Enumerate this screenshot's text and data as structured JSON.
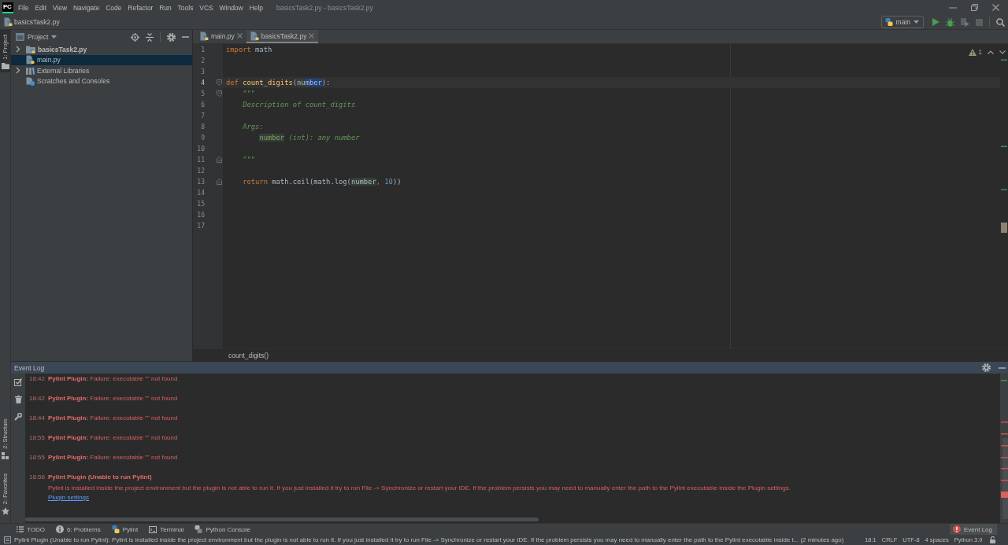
{
  "menu_bar": {
    "logo": "PC",
    "items": [
      "File",
      "Edit",
      "View",
      "Navigate",
      "Code",
      "Refactor",
      "Run",
      "Tools",
      "VCS",
      "Window",
      "Help"
    ],
    "window_title": "basicsTask2.py - basicsTask2.py"
  },
  "nav_bar": {
    "breadcrumb": "basicsTask2.py",
    "run_config": "main",
    "actions": [
      {
        "kind": "run",
        "disabled": false
      },
      {
        "kind": "debug",
        "disabled": false
      },
      {
        "kind": "coverage",
        "disabled": true
      },
      {
        "kind": "stop",
        "disabled": true
      },
      {
        "kind": "search",
        "disabled": false
      }
    ]
  },
  "left_stripe": {
    "top": [
      {
        "kind": "project",
        "label": "1: Project",
        "selected": true
      }
    ],
    "bottom": [
      {
        "kind": "structure",
        "label": "2: Structure",
        "selected": false
      },
      {
        "kind": "favorites",
        "label": "2: Favorites",
        "selected": false
      }
    ]
  },
  "project_panel": {
    "title": "Project",
    "tree": [
      {
        "kind": "project",
        "label": "basicsTask2.py",
        "expanded": false,
        "selected": false
      },
      {
        "kind": "file",
        "label": "main.py",
        "selected": true
      },
      {
        "kind": "library",
        "label": "External Libraries",
        "expanded": false,
        "selected": false
      },
      {
        "kind": "scratches",
        "label": "Scratches and Consoles",
        "selected": false
      }
    ]
  },
  "editor": {
    "tabs": [
      {
        "label": "main.py",
        "selected": false
      },
      {
        "label": "basicsTask2.py",
        "selected": true
      }
    ],
    "inspection_count": "1",
    "lines": [
      {
        "number": "1",
        "kind": "code",
        "current": false,
        "tokens": [
          {
            "text": "import",
            "kind": "keyword"
          },
          {
            "text": " math",
            "kind": "plain"
          }
        ]
      },
      {
        "number": "2",
        "kind": "code",
        "current": false
      },
      {
        "number": "3",
        "kind": "code",
        "current": false
      },
      {
        "number": "4",
        "kind": "fold-start",
        "current": true,
        "tokens": [
          {
            "text": "def ",
            "kind": "keyword"
          },
          {
            "text": "count_digits",
            "kind": "function"
          },
          {
            "text": "(",
            "kind": "plain"
          },
          {
            "text": "nu",
            "kind": "usage"
          },
          {
            "text": "mber",
            "kind": "selection"
          },
          {
            "text": "):",
            "kind": "plain"
          }
        ]
      },
      {
        "number": "5",
        "kind": "fold-start",
        "current": false,
        "tokens": [
          {
            "text": "    \"\"\"",
            "kind": "docstring"
          }
        ]
      },
      {
        "number": "6",
        "kind": "code",
        "current": false,
        "tokens": [
          {
            "text": "    Description of count_digits",
            "kind": "docstring"
          }
        ]
      },
      {
        "number": "7",
        "kind": "code",
        "current": false
      },
      {
        "number": "8",
        "kind": "code",
        "current": false,
        "tokens": [
          {
            "text": "    Args:",
            "kind": "docstring"
          }
        ]
      },
      {
        "number": "9",
        "kind": "code",
        "current": false,
        "tokens": [
          {
            "text": "        number",
            "kind": "doc-usage"
          },
          {
            "text": " (int): any number",
            "kind": "docstring"
          }
        ]
      },
      {
        "number": "10",
        "kind": "code",
        "current": false
      },
      {
        "number": "11",
        "kind": "fold-end",
        "current": false,
        "tokens": [
          {
            "text": "    \"\"\"",
            "kind": "docstring"
          }
        ]
      },
      {
        "number": "12",
        "kind": "code",
        "current": false
      },
      {
        "number": "13",
        "kind": "fold-end",
        "current": false,
        "tokens": [
          {
            "text": "    return",
            "kind": "keyword"
          },
          {
            "text": " math.ceil(math.log(",
            "kind": "plain"
          },
          {
            "text": "number",
            "kind": "usage"
          },
          {
            "text": ", ",
            "kind": "separator"
          },
          {
            "text": "10",
            "kind": "number"
          },
          {
            "text": "))",
            "kind": "plain"
          }
        ]
      },
      {
        "number": "14",
        "kind": "code",
        "current": false
      },
      {
        "number": "15",
        "kind": "code",
        "current": false
      },
      {
        "number": "16",
        "kind": "code",
        "current": false
      },
      {
        "number": "17",
        "kind": "code",
        "current": false
      }
    ],
    "breadcrumb": "count_digits()"
  },
  "event_log": {
    "title": "Event Log",
    "entries": [
      {
        "time": "18:42",
        "text": "**Pylint Plugin:** Failure: executable \"\" not found"
      },
      {
        "time": "18:42",
        "text": "**Pylint Plugin:** Failure: executable \"\" not found"
      },
      {
        "time": "18:44",
        "text": "**Pylint Plugin:** Failure: executable \"\" not found"
      },
      {
        "time": "18:55",
        "text": "**Pylint Plugin:** Failure: executable \"\" not found"
      },
      {
        "time": "18:55",
        "text": "**Pylint Plugin:** Failure: executable \"\" not found"
      },
      {
        "time": "18:56",
        "title": "Pylint Plugin (Unable to run Pylint)",
        "body": "Pylint is installed inside the project environment but the plugin is not able to run it. If you just installed it try to run File -> Synchronize or restart your IDE. If the problem persists you may need to manually enter the path to the Pylint executable inside the Plugin settings.",
        "link": "Plugin settings"
      }
    ]
  },
  "tool_window_bar": {
    "left": [
      {
        "kind": "todo",
        "label": "TODO",
        "selected": false
      },
      {
        "kind": "problems",
        "label": "6: Problems",
        "selected": false
      },
      {
        "kind": "pylint",
        "label": "Pylint",
        "selected": false
      },
      {
        "kind": "terminal",
        "label": "Terminal",
        "selected": false
      },
      {
        "kind": "console",
        "label": "Python Console",
        "selected": false
      }
    ],
    "right": [
      {
        "kind": "event-log",
        "label": "Event Log",
        "selected": true
      }
    ]
  },
  "status_bar": {
    "message": "Pylint Plugin (Unable to run Pylint): Pylint is installed inside the project environment but the plugin is not able to run it. If you just installed it try to run File -> Synchronize or restart your IDE. If the problem persists you may need to manually enter the path to the Pylint executable inside t... (2 minutes ago)",
    "items": [
      "18:1",
      "CRLF",
      "UTF-8",
      "4 spaces",
      "Python 3.9"
    ]
  }
}
